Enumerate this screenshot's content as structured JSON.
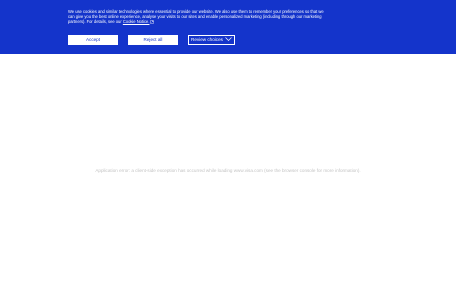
{
  "cookie_banner": {
    "text": "We use cookies and similar technologies where essential to provide our website. We also use them to remember your preferences so that we can give you the best online experience, analyse your visits to our sites and enable personalized marketing (including through our marketing partners). For details, see our",
    "link_label": "Cookie Notice.",
    "link_icon": "external-link-icon",
    "accept_label": "Accept",
    "reject_label": "Reject all",
    "review_label": "Review choices",
    "review_icon": "chevron-down-icon",
    "background_color": "#1434cb"
  },
  "main": {
    "error_message": "Application error: a client-side exception has occurred while loading www.visa.com (see the browser console for more information)."
  }
}
